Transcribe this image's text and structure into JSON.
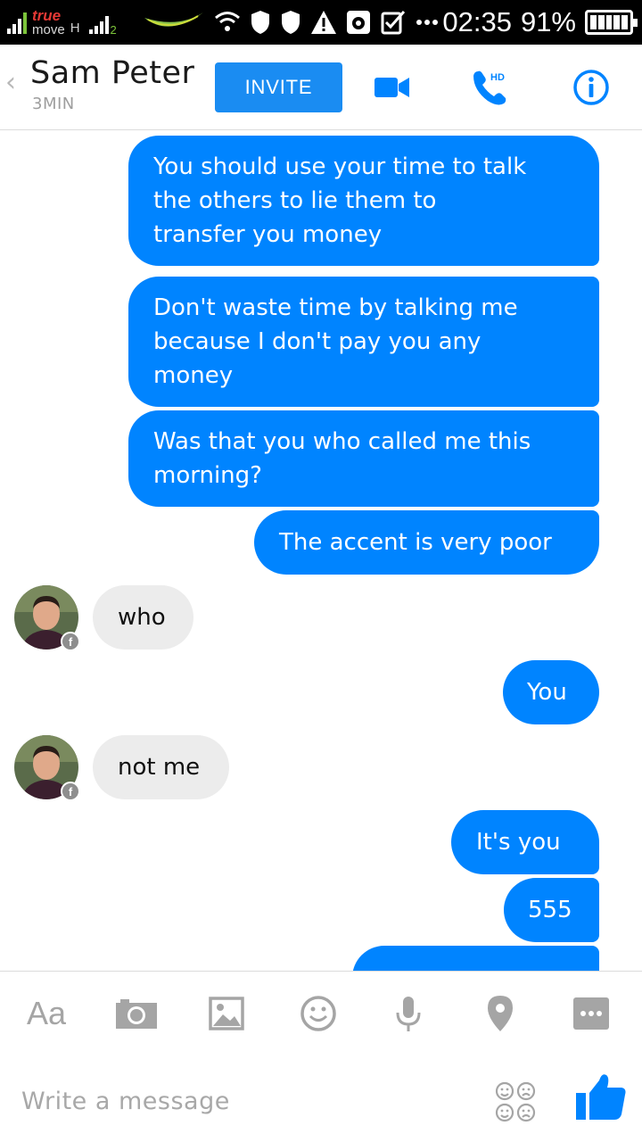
{
  "status_bar": {
    "carrier_line1": "true",
    "carrier_line2": "move",
    "network_type": "H",
    "sim2_label": "2",
    "time": "02:35",
    "battery_percent": "91%",
    "battery_level": 0.91,
    "notification_icons": [
      "wifi-icon",
      "shield-icon",
      "shield-icon",
      "warning-icon",
      "camera-app-icon",
      "clipboard-check-icon",
      "more-dots-icon"
    ]
  },
  "header": {
    "back_label": "‹",
    "contact_name": "Sam Peter",
    "last_seen": "3MIN",
    "invite_label": "INVITE",
    "hd_label": "HD",
    "accent_color": "#0084ff"
  },
  "messages": [
    {
      "direction": "outgoing",
      "lines": [
        "You should use your time to talk",
        "the others to lie them to",
        "transfer you money"
      ]
    },
    {
      "direction": "outgoing",
      "lines": [
        "Don't waste time by talking me",
        "because I don't pay you any",
        "money"
      ]
    },
    {
      "direction": "outgoing",
      "lines": [
        "Was that you who called me this",
        "morning?"
      ]
    },
    {
      "direction": "outgoing",
      "lines": [
        "The accent is very poor"
      ]
    },
    {
      "direction": "incoming",
      "lines": [
        "who"
      ]
    },
    {
      "direction": "outgoing",
      "lines": [
        "You"
      ]
    },
    {
      "direction": "incoming",
      "lines": [
        "not me"
      ]
    },
    {
      "direction": "outgoing",
      "lines": [
        "It's you"
      ]
    },
    {
      "direction": "outgoing",
      "lines": [
        "555"
      ]
    }
  ],
  "composer": {
    "text_tool_label": "Aa",
    "placeholder": "Write a message",
    "toolbar_icons": [
      "text-format-icon",
      "camera-icon",
      "gallery-icon",
      "emoji-icon",
      "microphone-icon",
      "location-pin-icon",
      "more-options-icon"
    ],
    "stickers_icon": "stickers-icon",
    "send_icon": "thumbs-up-icon"
  },
  "colors": {
    "outgoing_bubble": "#0084ff",
    "incoming_bubble": "#ececec",
    "invite_button": "#1a8cf2",
    "icon_gray": "#a5a5a5"
  }
}
